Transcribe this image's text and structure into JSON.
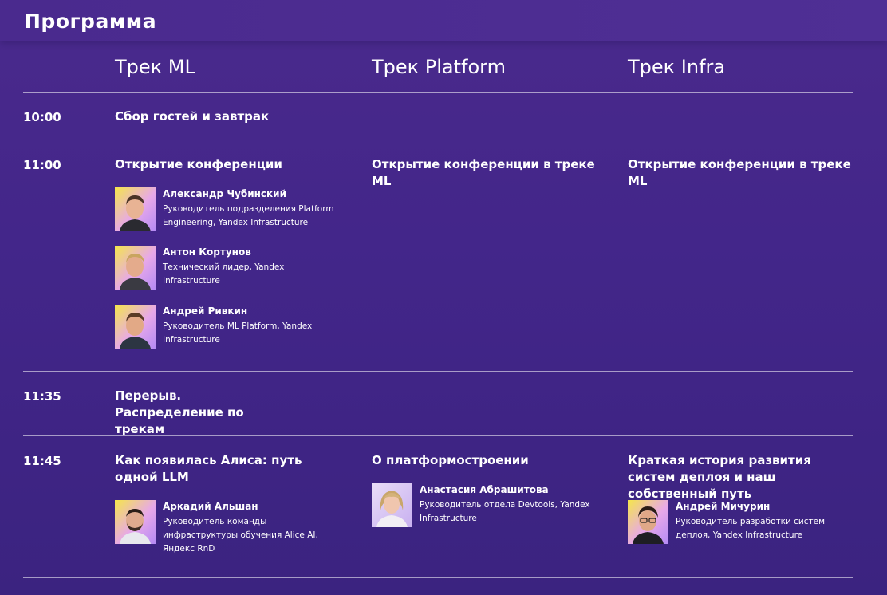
{
  "page": {
    "title": "Программа"
  },
  "tracks": [
    "Трек ML",
    "Трек Platform",
    "Трек Infra"
  ],
  "rows": [
    {
      "time": "10:00",
      "ml": "Сбор гостей и завтрак"
    },
    {
      "time": "11:00",
      "ml": "Открытие конференции",
      "platform": "Открытие конференции в треке ML",
      "infra": "Открытие конференции в треке ML",
      "speakers": [
        {
          "name": "Александр Чубинский",
          "role": "Руководитель подразделения Platform Engineering, Yandex Infrastructure"
        },
        {
          "name": "Антон Кортунов",
          "role": "Технический лидер, Yandex Infrastructure"
        },
        {
          "name": "Андрей Ривкин",
          "role": "Руководитель ML Platform, Yandex Infrastructure"
        }
      ]
    },
    {
      "time": "11:35",
      "ml": "Перерыв. Распределение по трекам"
    },
    {
      "time": "11:45",
      "ml": "Как появилась Алиса: путь одной LLM",
      "platform": "О платформостроении",
      "infra": "Краткая история развития систем деплоя и наш собственный путь",
      "ml_speaker": {
        "name": "Аркадий Альшан",
        "role": "Руководитель команды инфраструктуры обучения Alice AI, Яндекс RnD"
      },
      "platform_speaker": {
        "name": "Анастасия Абрашитова",
        "role": "Руководитель отдела Devtools, Yandex Infrastructure"
      },
      "infra_speaker": {
        "name": "Андрей Мичурин",
        "role": "Руководитель разработки систем деплоя, Yandex Infrastructure"
      }
    }
  ],
  "colors": {
    "background": "#43268a",
    "avatar_yellow": "#f2e24a",
    "avatar_violet": "#b98cf5"
  }
}
